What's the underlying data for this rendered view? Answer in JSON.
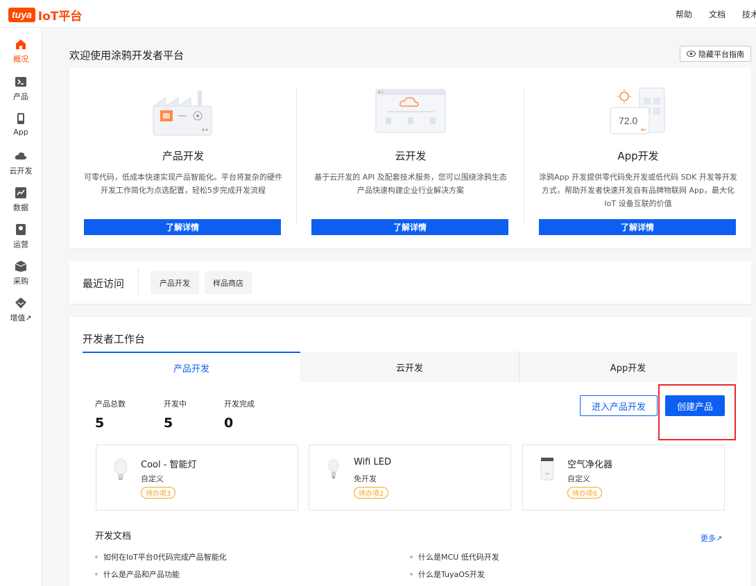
{
  "topbar": {
    "logo_badge": "tuya",
    "logo_text": "IoT平台",
    "links": [
      "帮助",
      "文档",
      "技术"
    ]
  },
  "sidebar": {
    "items": [
      {
        "label": "概况",
        "icon": "home-icon",
        "active": true
      },
      {
        "label": "产品",
        "icon": "terminal-icon",
        "active": false
      },
      {
        "label": "App",
        "icon": "phone-icon",
        "active": false
      },
      {
        "label": "云开发",
        "icon": "cloud-icon",
        "active": false
      },
      {
        "label": "数据",
        "icon": "chart-icon",
        "active": false
      },
      {
        "label": "运营",
        "icon": "badge-icon",
        "active": false
      },
      {
        "label": "采购",
        "icon": "box-icon",
        "active": false
      },
      {
        "label": "增值↗",
        "icon": "gem-icon",
        "active": false
      }
    ]
  },
  "welcome": {
    "title": "欢迎使用涂鸦开发者平台",
    "hide_guide": "隐藏平台指南"
  },
  "features": [
    {
      "title": "产品开发",
      "desc": "可零代码，低成本快速实现产品智能化。平台将复杂的硬件开发工作简化为点选配置，轻松5步完成开发流程",
      "button": "了解详情"
    },
    {
      "title": "云开发",
      "desc": "基于云开发的 API 及配套技术服务，您可以围绕涂鸦生态产品快速构建企业行业解决方案",
      "button": "了解详情"
    },
    {
      "title": "App开发",
      "desc": "涂鸦App 开发提供零代码免开发或低代码 SDK 开发等开发方式，帮助开发者快速开发自有品牌物联网 App，最大化 IoT 设备互联的价值",
      "button": "了解详情",
      "illus_temp": "72.0"
    }
  ],
  "recent": {
    "label": "最近访问",
    "chips": [
      "产品开发",
      "样品商店"
    ]
  },
  "workbench": {
    "title": "开发者工作台",
    "tabs": [
      "产品开发",
      "云开发",
      "App开发"
    ],
    "active_tab": 0,
    "stats": [
      {
        "label": "产品总数",
        "value": "5"
      },
      {
        "label": "开发中",
        "value": "5"
      },
      {
        "label": "开发完成",
        "value": "0"
      }
    ],
    "enter_button": "进入产品开发",
    "create_button": "创建产品",
    "annotation": "1",
    "products": [
      {
        "name": "Cool - 智能灯",
        "type": "自定义",
        "badge": "待办项3",
        "icon": "bulb-icon"
      },
      {
        "name": "Wifi LED",
        "type": "免开发",
        "badge": "待办项2",
        "icon": "bulb-icon"
      },
      {
        "name": "空气净化器",
        "type": "自定义",
        "badge": "待办项6",
        "icon": "air-purifier-icon"
      }
    ],
    "docs_title": "开发文档",
    "more": "更多↗",
    "docs": [
      "如何在IoT平台0代码完成产品智能化",
      "什么是MCU 低代码开发",
      "什么是产品和产品功能",
      "什么是TuyaOS开发"
    ]
  },
  "colors": {
    "brand": "#ff4800",
    "primary": "#0d5ff2",
    "badge": "#f5a623",
    "annotation": "#e8282b"
  }
}
